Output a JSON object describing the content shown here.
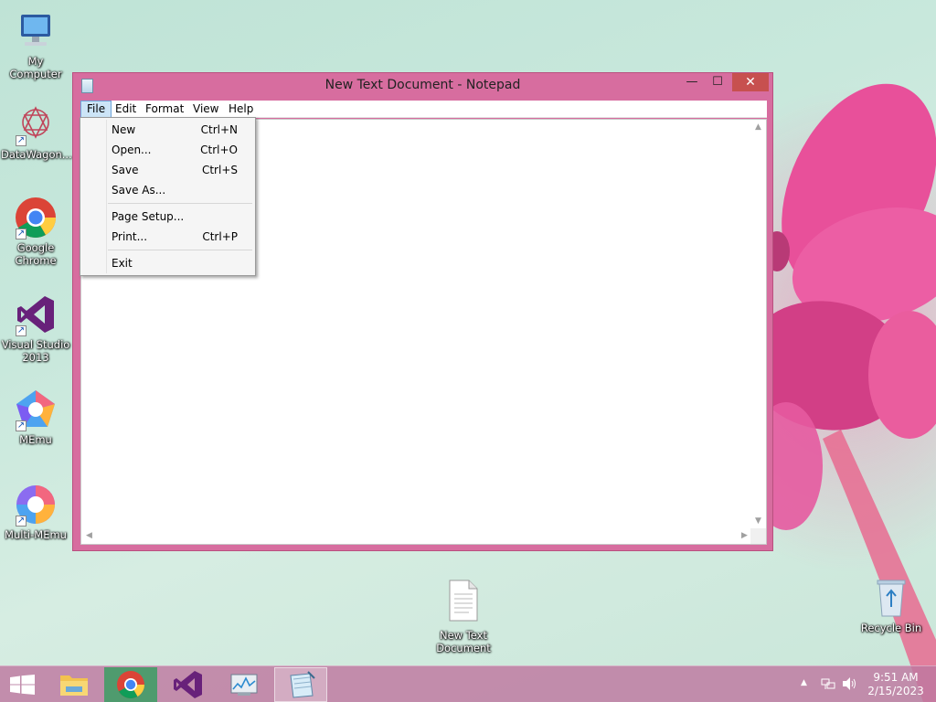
{
  "desktop": {
    "icons": [
      {
        "label": "My Computer"
      },
      {
        "label": "DataWagon..."
      },
      {
        "label": "Google Chrome"
      },
      {
        "label": "Visual Studio 2013"
      },
      {
        "label": "MEmu"
      },
      {
        "label": "Multi-MEmu"
      },
      {
        "label": "New Text Document"
      },
      {
        "label": "Recycle Bin"
      }
    ]
  },
  "window": {
    "title": "New Text Document - Notepad",
    "controls": {
      "minimize": "—",
      "maximize": "☐",
      "close": "✕"
    },
    "menu": [
      "File",
      "Edit",
      "Format",
      "View",
      "Help"
    ],
    "active_menu": "File",
    "editor_text": ""
  },
  "file_menu": {
    "items": [
      {
        "label": "New",
        "shortcut": "Ctrl+N"
      },
      {
        "label": "Open...",
        "shortcut": "Ctrl+O"
      },
      {
        "label": "Save",
        "shortcut": "Ctrl+S"
      },
      {
        "label": "Save As...",
        "shortcut": ""
      },
      {
        "label": "Page Setup...",
        "shortcut": ""
      },
      {
        "label": "Print...",
        "shortcut": "Ctrl+P"
      },
      {
        "label": "Exit",
        "shortcut": ""
      }
    ]
  },
  "taskbar": {
    "apps": [
      "file-explorer",
      "google-chrome",
      "visual-studio",
      "task-manager",
      "notepad"
    ],
    "active_app": "notepad",
    "tray": {
      "show_hidden": "▲"
    },
    "clock": {
      "time": "9:51 AM",
      "date": "2/15/2023"
    }
  },
  "colors": {
    "window_frame": "#d76d9f",
    "close_button": "#c7504f",
    "menu_highlight": "#cce4f7",
    "taskbar": "#be78a0"
  }
}
